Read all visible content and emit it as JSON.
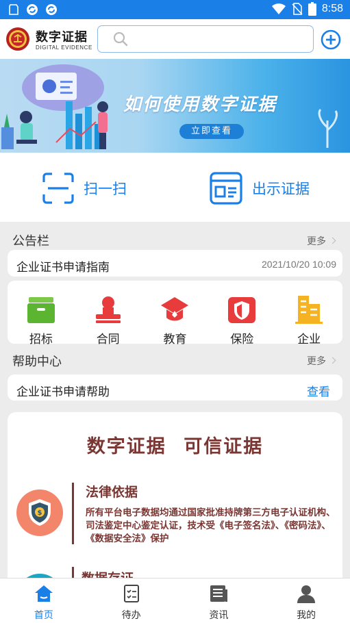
{
  "status_bar": {
    "time": "8:58"
  },
  "header": {
    "brand_cn": "数字证据",
    "brand_en": "DIGITAL EVIDENCE",
    "search_placeholder": ""
  },
  "banner": {
    "title": "如何使用数字证据",
    "cta": "立即查看"
  },
  "quick_actions": [
    {
      "label": "扫一扫",
      "icon": "scan-icon"
    },
    {
      "label": "出示证据",
      "icon": "id-card-icon"
    }
  ],
  "notice": {
    "title": "公告栏",
    "more": "更多",
    "item_text": "企业证书申请指南",
    "item_date": "2021/10/20 10:09"
  },
  "categories": [
    {
      "label": "招标",
      "icon": "tender-box-icon",
      "color": "#5cb531"
    },
    {
      "label": "合同",
      "icon": "seal-icon",
      "color": "#e83b3b"
    },
    {
      "label": "教育",
      "icon": "graduation-cap-icon",
      "color": "#e83b3b"
    },
    {
      "label": "保险",
      "icon": "shield-icon",
      "color": "#e83b3b"
    },
    {
      "label": "企业",
      "icon": "building-icon",
      "color": "#f5b324"
    }
  ],
  "help": {
    "title": "帮助中心",
    "more": "更多",
    "item_text": "企业证书申请帮助",
    "item_link": "查看"
  },
  "feature": {
    "headline": "数字证据  可信证据",
    "items": [
      {
        "title": "法律依据",
        "body": "所有平台电子数据均通过国家批准持牌第三方电子认证机构、司法鉴定中心鉴定认证，技术受《电子签名法》、《密码法》、《数据安全法》保护",
        "icon": "money-shield-icon"
      },
      {
        "title": "数据存证",
        "icon": "data-icon"
      }
    ]
  },
  "bottom_nav": [
    {
      "label": "首页",
      "icon": "home-icon",
      "active": true
    },
    {
      "label": "待办",
      "icon": "todo-icon",
      "active": false
    },
    {
      "label": "资讯",
      "icon": "news-icon",
      "active": false
    },
    {
      "label": "我的",
      "icon": "profile-icon",
      "active": false
    }
  ],
  "colors": {
    "accent": "#1a7fe6",
    "feature_text": "#7a3632"
  }
}
